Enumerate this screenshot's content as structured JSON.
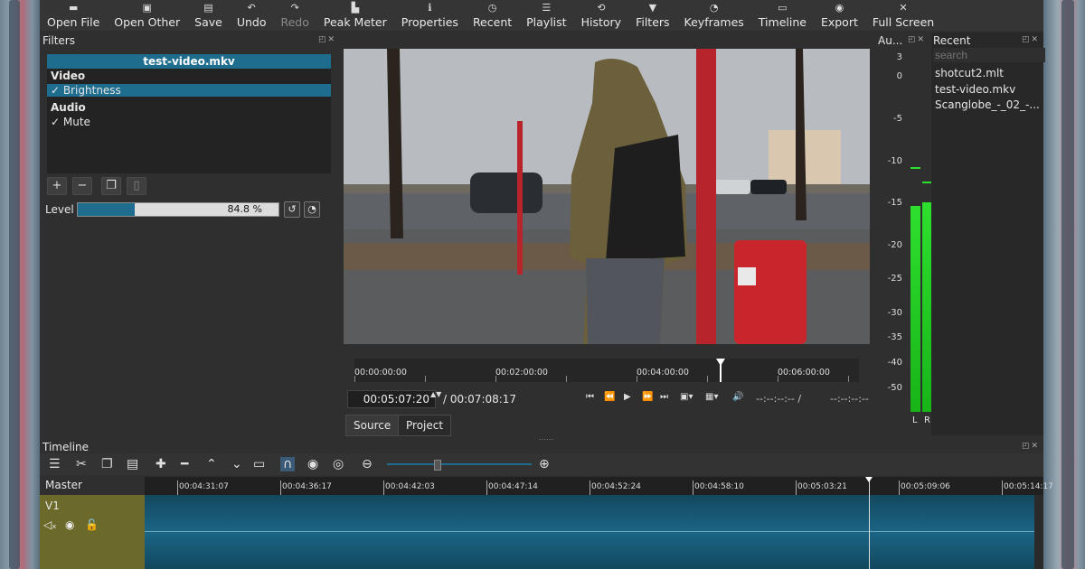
{
  "toolbar": {
    "items": [
      {
        "label": "Open File",
        "icon": "folder-icon"
      },
      {
        "label": "Open Other",
        "icon": "file-plus-icon"
      },
      {
        "label": "Save",
        "icon": "save-icon"
      },
      {
        "label": "Undo",
        "icon": "undo-icon"
      },
      {
        "label": "Redo",
        "icon": "redo-icon"
      },
      {
        "label": "Peak Meter",
        "icon": "meter-icon"
      },
      {
        "label": "Properties",
        "icon": "info-icon"
      },
      {
        "label": "Recent",
        "icon": "clock-icon"
      },
      {
        "label": "Playlist",
        "icon": "list-icon"
      },
      {
        "label": "History",
        "icon": "history-icon"
      },
      {
        "label": "Filters",
        "icon": "funnel-icon"
      },
      {
        "label": "Keyframes",
        "icon": "stopwatch-icon"
      },
      {
        "label": "Timeline",
        "icon": "timeline-icon"
      },
      {
        "label": "Export",
        "icon": "export-icon"
      },
      {
        "label": "Full Screen",
        "icon": "fullscreen-icon"
      }
    ]
  },
  "filters": {
    "title": "Filters",
    "file": "test-video.mkv",
    "video_group": "Video",
    "video_filter": "Brightness",
    "audio_group": "Audio",
    "audio_filter": "Mute",
    "level_label": "Level",
    "level_value": "84.8 %",
    "level_fraction": 0.284
  },
  "viewer": {
    "ruler_labels": [
      "00:00:00:00",
      "00:02:00:00",
      "00:04:00:00",
      "00:06:00:00"
    ],
    "current_time": "00:05:07:20",
    "total_time": "/ 00:07:08:17",
    "in_point": "--:--:--:-- /",
    "out_point": "--:--:--:--",
    "tabs": [
      "Source",
      "Project"
    ]
  },
  "audio_meter": {
    "title": "Au...",
    "scale": [
      "3",
      "0",
      "-5",
      "-10",
      "-15",
      "-20",
      "-25",
      "-30",
      "-35",
      "-40",
      "-50"
    ],
    "left_label": "L",
    "right_label": "R"
  },
  "recent": {
    "title": "Recent",
    "search_placeholder": "search",
    "items": [
      "shotcut2.mlt",
      "test-video.mkv",
      "Scanglobe_-_02_-..."
    ]
  },
  "timeline": {
    "title": "Timeline",
    "master": "Master",
    "track": "V1",
    "ruler_labels": [
      "00:04:31:07",
      "00:04:36:17",
      "00:04:42:03",
      "00:04:47:14",
      "00:04:52:24",
      "00:04:58:10",
      "00:05:03:21",
      "00:05:09:06",
      "00:05:14:17"
    ]
  },
  "colors": {
    "accent": "#1e6d8e",
    "track_head": "#6b6a2a",
    "meter": "#2ee02e"
  }
}
